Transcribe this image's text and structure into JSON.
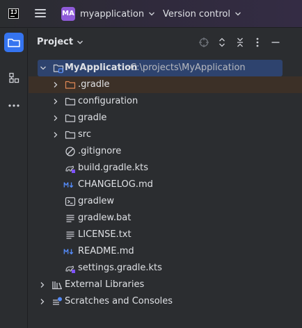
{
  "titlebar": {
    "logo_text": "IJ",
    "project_badge": "MA",
    "project_badge_color": "#8f5bd8",
    "project_name": "myapplication",
    "vcs_label": "Version control"
  },
  "stripe": {
    "items": [
      {
        "icon": "folder-icon",
        "active": true
      },
      {
        "icon": "structure-icon",
        "active": false
      },
      {
        "icon": "more-icon",
        "active": false
      }
    ]
  },
  "panel": {
    "title": "Project",
    "toolbar": [
      "locate-icon",
      "expand-all-icon",
      "collapse-all-icon",
      "options-icon",
      "hide-icon"
    ]
  },
  "tree": {
    "root": {
      "label": "MyApplication",
      "path": "C:\\projects\\MyApplication"
    },
    "items": [
      {
        "label": ".gradle",
        "type": "folder-excluded"
      },
      {
        "label": "configuration",
        "type": "folder"
      },
      {
        "label": "gradle",
        "type": "folder"
      },
      {
        "label": "src",
        "type": "folder"
      },
      {
        "label": ".gitignore",
        "type": "gitignore"
      },
      {
        "label": "build.gradle.kts",
        "type": "gradle"
      },
      {
        "label": "CHANGELOG.md",
        "type": "markdown"
      },
      {
        "label": "gradlew",
        "type": "shell"
      },
      {
        "label": "gradlew.bat",
        "type": "text"
      },
      {
        "label": "LICENSE.txt",
        "type": "text"
      },
      {
        "label": "README.md",
        "type": "markdown"
      },
      {
        "label": "settings.gradle.kts",
        "type": "gradle"
      }
    ],
    "external_libraries": "External Libraries",
    "scratches": "Scratches and Consoles"
  },
  "colors": {
    "accent": "#3574f0",
    "selection": "#2e436e",
    "hover": "#3c3027",
    "excluded_folder": "#e08855"
  }
}
